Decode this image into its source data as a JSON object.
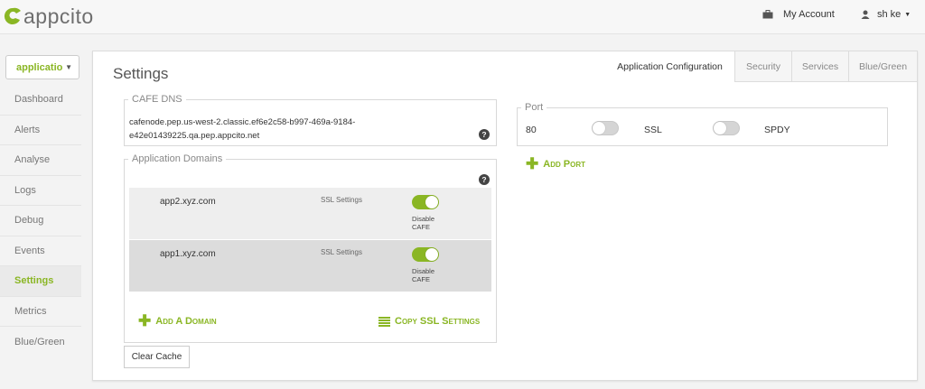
{
  "brand": {
    "name": "appcito"
  },
  "header": {
    "my_account": "My Account",
    "user": "sh ke"
  },
  "sidebar": {
    "app_select": "applicatio",
    "items": [
      {
        "label": "Dashboard",
        "active": false
      },
      {
        "label": "Alerts",
        "active": false
      },
      {
        "label": "Analyse",
        "active": false
      },
      {
        "label": "Logs",
        "active": false
      },
      {
        "label": "Debug",
        "active": false
      },
      {
        "label": "Events",
        "active": false
      },
      {
        "label": "Settings",
        "active": true
      },
      {
        "label": "Metrics",
        "active": false
      },
      {
        "label": "Blue/Green",
        "active": false
      }
    ]
  },
  "main": {
    "title": "Settings",
    "tabs": [
      {
        "label": "Application Configuration",
        "active": true
      },
      {
        "label": "Security",
        "active": false
      },
      {
        "label": "Services",
        "active": false
      },
      {
        "label": "Blue/Green",
        "active": false
      }
    ],
    "cafe_dns": {
      "legend": "CAFE DNS",
      "line1": "cafenode.pep.us-west-2.classic.ef6e2c58-b997-469a-9184-",
      "line2": "e42e01439225.qa.pep.appcito.net"
    },
    "app_domains": {
      "legend": "Application Domains",
      "rows": [
        {
          "domain": "app2.xyz.com",
          "ssl_label": "SSL Settings",
          "toggle_label_1": "Disable",
          "toggle_label_2": "CAFE",
          "enabled": true
        },
        {
          "domain": "app1.xyz.com",
          "ssl_label": "SSL Settings",
          "toggle_label_1": "Disable",
          "toggle_label_2": "CAFE",
          "enabled": true
        }
      ],
      "add_domain": "Add A Domain",
      "copy_ssl": "Copy SSL Settings"
    },
    "port": {
      "legend": "Port",
      "value": "80",
      "ssl_label": "SSL",
      "spdy_label": "SPDY",
      "ssl_enabled": false,
      "spdy_enabled": false,
      "add_port": "Add Port"
    },
    "clear_cache": "Clear Cache"
  },
  "colors": {
    "accent": "#8ab624",
    "background": "#f3f3f3",
    "panel": "#ffffff"
  }
}
